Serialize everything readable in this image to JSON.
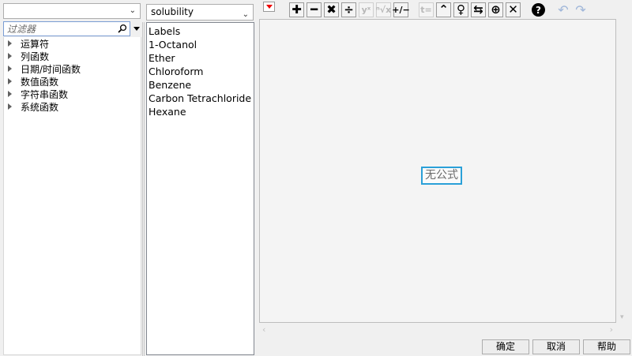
{
  "left_panel": {
    "category_select_value": "",
    "filter_placeholder": "过滤器",
    "tree_items": [
      "运算符",
      "列函数",
      "日期/时间函数",
      "数值函数",
      "字符串函数",
      "系统函数"
    ]
  },
  "middle_panel": {
    "table_select_value": "solubility",
    "columns": [
      "Labels",
      "1-Octanol",
      "Ether",
      "Chloroform",
      "Benzene",
      "Carbon Tetrachloride",
      "Hexane"
    ]
  },
  "toolbar": {
    "menu_icon": "red-triangle-menu-icon",
    "buttons": [
      {
        "name": "add-button",
        "glyph": "✚"
      },
      {
        "name": "subtract-button",
        "glyph": "━"
      },
      {
        "name": "multiply-button",
        "glyph": "✖"
      },
      {
        "name": "divide-button",
        "glyph": "÷"
      },
      {
        "name": "power-button",
        "glyph": "yˣ"
      },
      {
        "name": "root-button",
        "glyph": "ⁿ√x"
      },
      {
        "name": "negate-button",
        "glyph": "+∕−"
      },
      {
        "name": "local-variable-button",
        "glyph": "t="
      },
      {
        "name": "raise-button",
        "glyph": "⌃"
      },
      {
        "name": "peel-button",
        "glyph": "♀"
      },
      {
        "name": "swap-button",
        "glyph": "⇆"
      },
      {
        "name": "unary-button",
        "glyph": "⊕"
      },
      {
        "name": "delete-button",
        "glyph": "✕"
      },
      {
        "name": "help-button",
        "glyph": "?"
      }
    ]
  },
  "formula": {
    "placeholder_text": "无公式"
  },
  "footer": {
    "ok_label": "确定",
    "cancel_label": "取消",
    "help_label": "帮助"
  },
  "colors": {
    "accent": "#2aa0d8",
    "menu_red": "#e00000",
    "panel_bg": "#f0f0f0"
  }
}
